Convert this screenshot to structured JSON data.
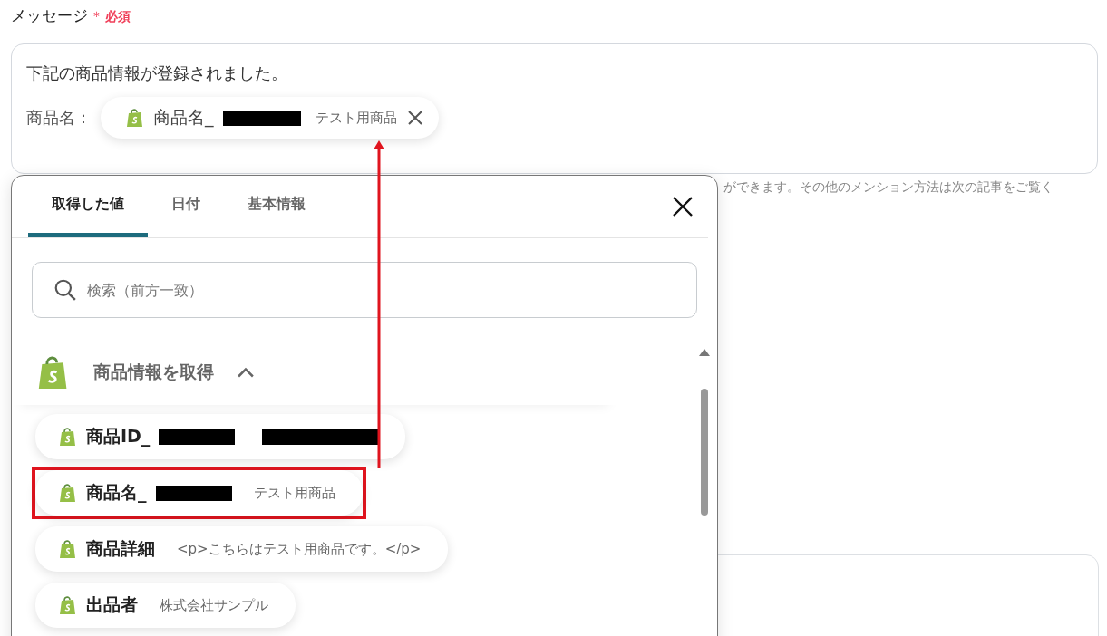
{
  "field": {
    "label": "メッセージ",
    "required_mark": "＊",
    "required_text": "必須"
  },
  "message": {
    "line": "下記の商品情報が登録されました。",
    "rows": [
      {
        "label": "商品名：",
        "chip": {
          "name": "商品名_",
          "redacted": true,
          "value": "テスト用商品"
        }
      }
    ]
  },
  "helper_text": "ができます。その他のメンション方法は次の記事をご覧く",
  "popup": {
    "tabs": [
      {
        "label": "取得した値",
        "selected": true
      },
      {
        "label": "日付",
        "selected": false
      },
      {
        "label": "基本情報",
        "selected": false
      }
    ],
    "search": {
      "placeholder": "検索（前方一致）"
    },
    "group": {
      "title": "商品情報を取得",
      "expanded": true,
      "items": [
        {
          "name": "商品ID_",
          "redacted": true,
          "value_redacted": true,
          "annotated": false
        },
        {
          "name": "商品名_",
          "redacted": true,
          "value": "テスト用商品",
          "annotated": true
        },
        {
          "name": "商品詳細",
          "redacted": false,
          "value": "<p>こちらはテスト用商品です。</p>",
          "annotated": false
        },
        {
          "name": "出品者",
          "redacted": false,
          "value": "株式会社サンプル",
          "annotated": false
        }
      ]
    }
  }
}
